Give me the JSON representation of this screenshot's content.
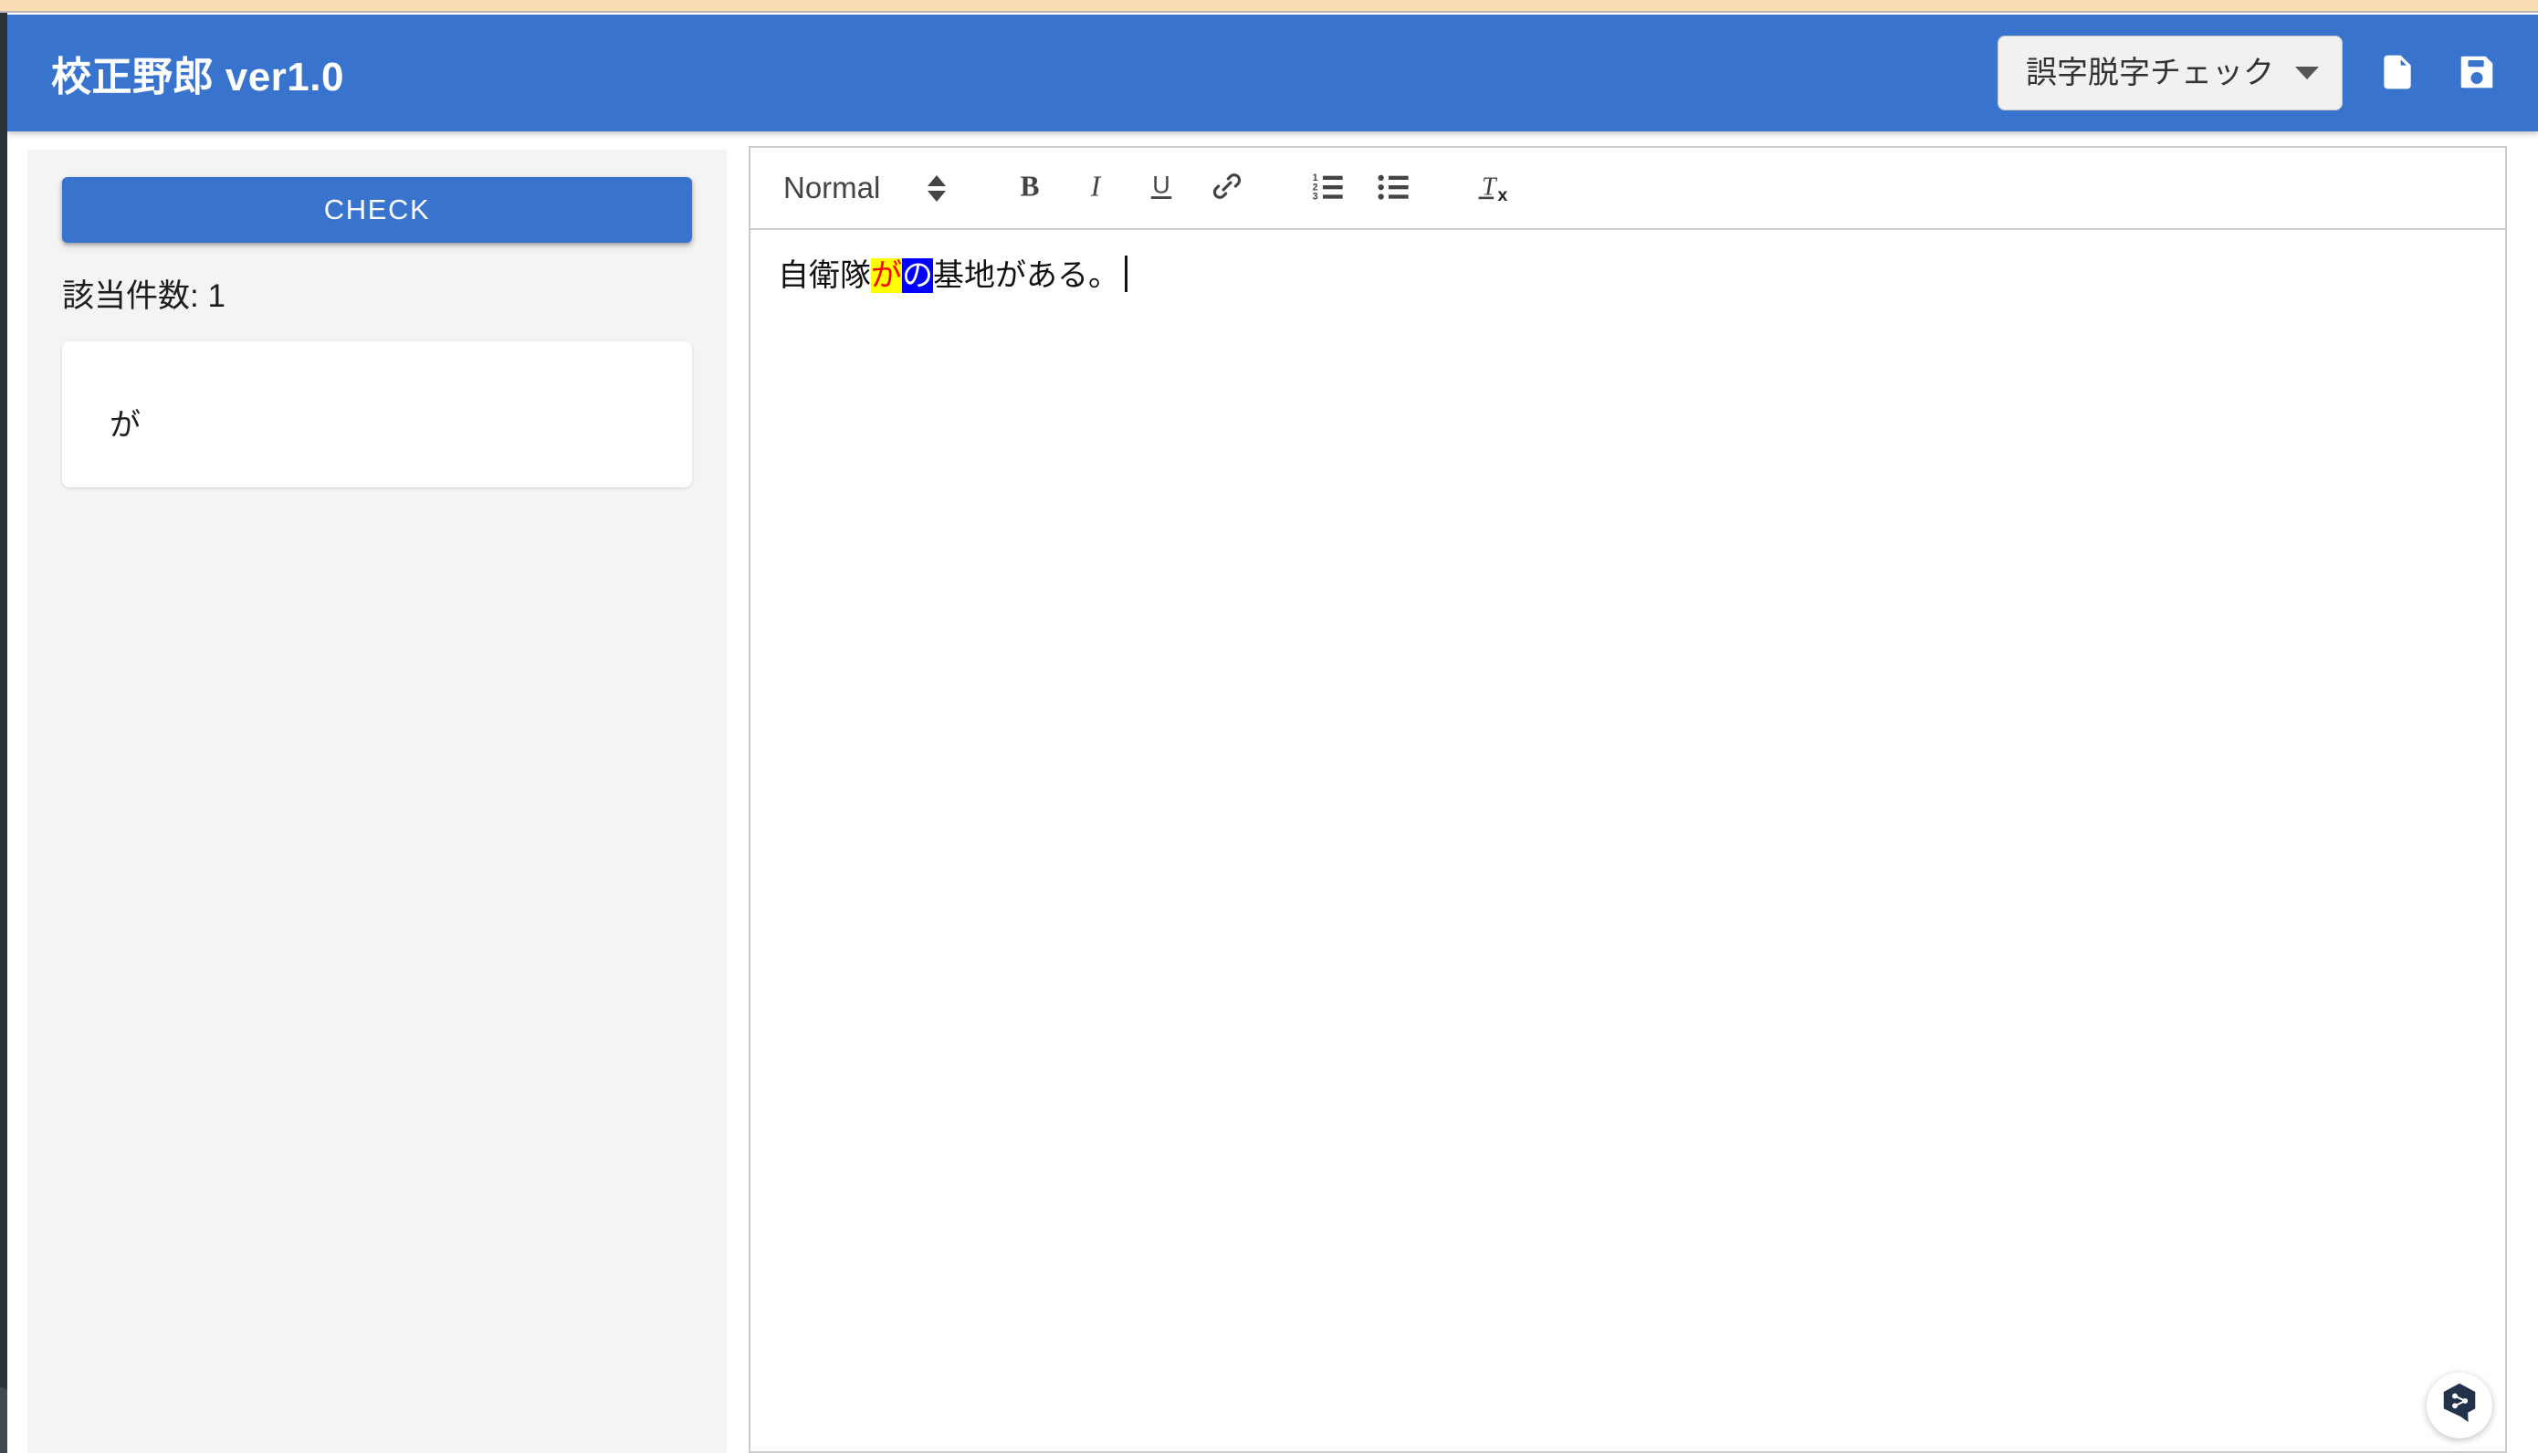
{
  "header": {
    "title": "校正野郎 ver1.0",
    "accent_color": "#3873ce",
    "check_mode": {
      "selected": "誤字脱字チェック",
      "options": [
        "誤字脱字チェック"
      ]
    },
    "upload_icon": "file-upload-icon",
    "save_icon": "save-icon"
  },
  "sidebar": {
    "check_label": "CHECK",
    "result_count_label": "該当件数: 1",
    "results": [
      {
        "text": "が"
      }
    ]
  },
  "editor": {
    "toolbar": {
      "format_label": "Normal",
      "bold_label": "B",
      "italic_label": "I",
      "underline_label": "U",
      "link_icon": "link-icon",
      "ordered_list_icon": "ordered-list-icon",
      "bullet_list_icon": "bullet-list-icon",
      "clear_format_label": "Tx"
    },
    "content": {
      "before": "自衛隊",
      "suggestion": "が",
      "selected": "の",
      "after": "基地がある。",
      "suggestion_bg": "#ffff00",
      "suggestion_fg": "#ff0000",
      "selected_bg": "#0000ff",
      "selected_fg": "#ffffff"
    }
  },
  "chat_widget": {
    "icon": "chat-hexagon-share-icon",
    "color": "#21324a"
  }
}
